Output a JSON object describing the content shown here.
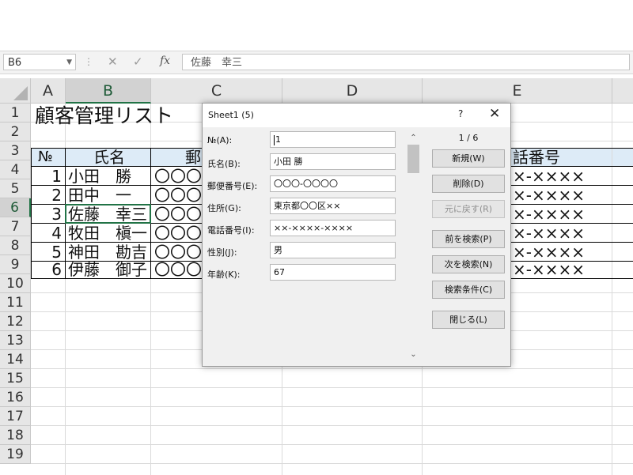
{
  "formula_bar": {
    "name_box": "B6",
    "cancel_icon": "✕",
    "enter_icon": "✓",
    "fx_label": "fx",
    "value": "佐藤　幸三"
  },
  "columns": [
    "A",
    "B",
    "C",
    "D",
    "E"
  ],
  "rows": [
    "1",
    "2",
    "3",
    "4",
    "5",
    "6",
    "7",
    "8",
    "9",
    "10",
    "11",
    "12",
    "13",
    "14",
    "15",
    "16",
    "17",
    "18",
    "19"
  ],
  "selected": {
    "column": "B",
    "row": "6"
  },
  "sheet": {
    "title": "顧客管理リスト",
    "header": {
      "no": "№",
      "name": "氏名",
      "c_partial": "郵",
      "e_partial": "話番号"
    },
    "records": [
      {
        "no": "1",
        "name": "小田　勝",
        "c": "〇〇〇",
        "e": "×-××××"
      },
      {
        "no": "2",
        "name": "田中　一",
        "c": "〇〇〇",
        "e": "×-××××"
      },
      {
        "no": "3",
        "name": "佐藤　幸三",
        "c": "〇〇〇",
        "e": "×-××××"
      },
      {
        "no": "4",
        "name": "牧田　槇一",
        "c": "〇〇〇",
        "e": "×-××××"
      },
      {
        "no": "5",
        "name": "神田　勘吉",
        "c": "〇〇〇",
        "e": "×-××××"
      },
      {
        "no": "6",
        "name": "伊藤　御子",
        "c": "〇〇〇",
        "e": "×-××××"
      }
    ]
  },
  "dialog": {
    "title": "Sheet1 (5)",
    "help": "?",
    "close": "✕",
    "counter": "1 / 6",
    "scroll_up": "⌃",
    "scroll_down": "⌄",
    "fields": [
      {
        "label": "№(A):",
        "value": "1"
      },
      {
        "label": "氏名(B):",
        "value": "小田 勝"
      },
      {
        "label": "郵便番号(E):",
        "value": "〇〇〇-〇〇〇〇"
      },
      {
        "label": "住所(G):",
        "value": "東京都〇〇区××"
      },
      {
        "label": "電話番号(I):",
        "value": "××-××××-××××"
      },
      {
        "label": "性別(J):",
        "value": "男"
      },
      {
        "label": "年齢(K):",
        "value": "67"
      }
    ],
    "buttons": {
      "new": "新規(W)",
      "delete": "削除(D)",
      "restore": "元に戻す(R)",
      "find_prev": "前を検索(P)",
      "find_next": "次を検索(N)",
      "criteria": "検索条件(C)",
      "close": "閉じる(L)"
    }
  }
}
